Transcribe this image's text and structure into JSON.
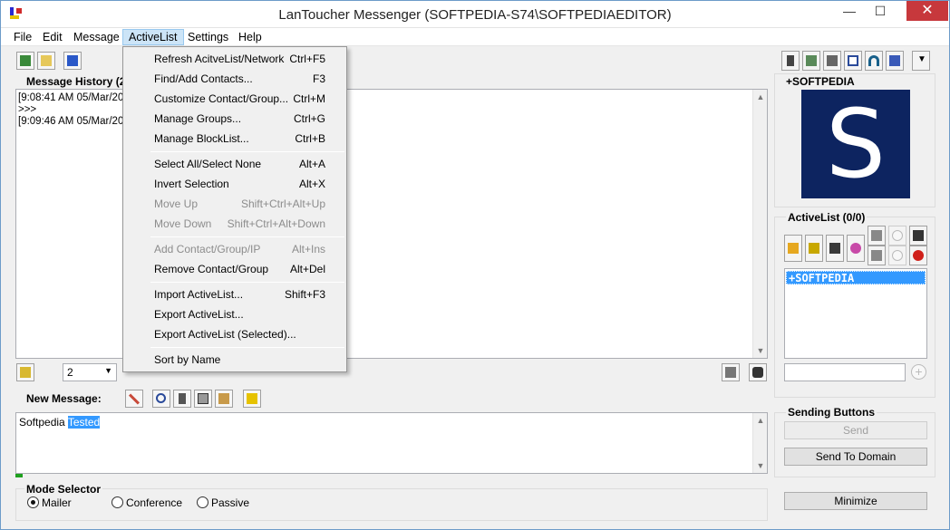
{
  "window": {
    "title": "LanToucher Messenger (SOFTPEDIA-S74\\SOFTPEDIAEDITOR)"
  },
  "titlebar_buttons": {
    "minimize": "—",
    "maximize": "☐",
    "close": "✕"
  },
  "menubar": [
    {
      "label": "File"
    },
    {
      "label": "Edit"
    },
    {
      "label": "Message"
    },
    {
      "label": "ActiveList"
    },
    {
      "label": "Settings"
    },
    {
      "label": "Help"
    }
  ],
  "activelist_menu": [
    {
      "label": "Refresh AcitveList/Network",
      "shortcut": "Ctrl+F5",
      "enabled": true
    },
    {
      "label": "Find/Add Contacts...",
      "shortcut": "F3",
      "enabled": true
    },
    {
      "label": "Customize Contact/Group...",
      "shortcut": "Ctrl+M",
      "enabled": true
    },
    {
      "label": "Manage Groups...",
      "shortcut": "Ctrl+G",
      "enabled": true
    },
    {
      "label": "Manage BlockList...",
      "shortcut": "Ctrl+B",
      "enabled": true
    },
    {
      "label": "Select All/Select None",
      "shortcut": "Alt+A",
      "enabled": true
    },
    {
      "label": "Invert Selection",
      "shortcut": "Alt+X",
      "enabled": true
    },
    {
      "label": "Move Up",
      "shortcut": "Shift+Ctrl+Alt+Up",
      "enabled": false
    },
    {
      "label": "Move Down",
      "shortcut": "Shift+Ctrl+Alt+Down",
      "enabled": false
    },
    {
      "label": "Add Contact/Group/IP",
      "shortcut": "Alt+Ins",
      "enabled": false
    },
    {
      "label": "Remove Contact/Group",
      "shortcut": "Alt+Del",
      "enabled": true
    },
    {
      "label": "Import ActiveList...",
      "shortcut": "Shift+F3",
      "enabled": true
    },
    {
      "label": "Export ActiveList...",
      "shortcut": "",
      "enabled": true
    },
    {
      "label": "Export ActiveList (Selected)...",
      "shortcut": "",
      "enabled": true
    },
    {
      "label": "Sort by Name",
      "shortcut": "",
      "enabled": true
    }
  ],
  "message_history": {
    "label": "Message History (2",
    "lines": [
      "[9:08:41 AM 05/Mar/201",
      ">>>",
      "[9:09:46 AM 05/Mar/201"
    ]
  },
  "history_count": {
    "value": "2"
  },
  "new_message": {
    "label": "New Message:",
    "text_plain": "Softpedia ",
    "text_selected": "Tested"
  },
  "mode_selector": {
    "label": "Mode Selector",
    "options": [
      {
        "label": "Mailer",
        "selected": true
      },
      {
        "label": "Conference",
        "selected": false
      },
      {
        "label": "Passive",
        "selected": false
      }
    ]
  },
  "profile": {
    "name": "+SOFTPEDIA",
    "avatar_letter": "S"
  },
  "activelist": {
    "label": "ActiveList (0/0)",
    "items": [
      "+SOFTPEDIA"
    ],
    "filter_value": ""
  },
  "sending_buttons": {
    "label": "Sending Buttons",
    "send": "Send",
    "send_to_domain": "Send To Domain"
  },
  "minimize_button": {
    "label": "Minimize"
  },
  "colors": {
    "menu_highlight": "#cce4f7",
    "selection": "#3399ff",
    "avatar_bg": "#0d2460",
    "close": "#c7383c"
  }
}
